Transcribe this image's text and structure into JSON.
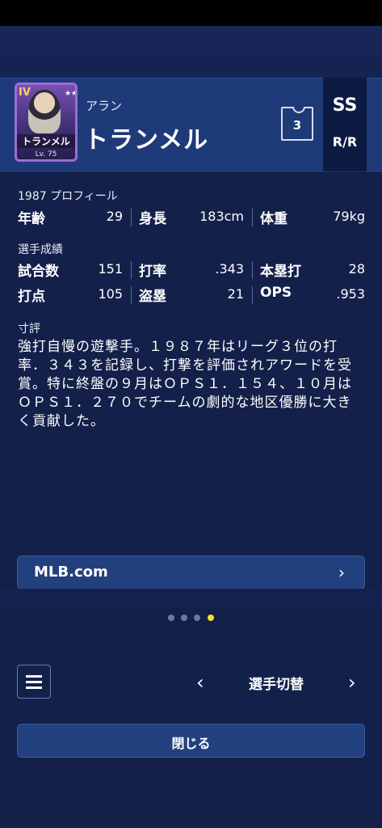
{
  "player": {
    "first_name": "アラン",
    "last_name": "トランメル",
    "card_name": "トランメル",
    "card_rank": "IV",
    "card_level": "Lv. 75",
    "number": "3",
    "position": "SS",
    "bats_throws": "R/R"
  },
  "profile": {
    "section_label": "1987 プロフィール",
    "age_label": "年齢",
    "age_value": "29",
    "height_label": "身長",
    "height_value": "183cm",
    "weight_label": "体重",
    "weight_value": "79kg"
  },
  "stats": {
    "section_label": "選手成績",
    "games_label": "試合数",
    "games_value": "151",
    "avg_label": "打率",
    "avg_value": ".343",
    "hr_label": "本塁打",
    "hr_value": "28",
    "rbi_label": "打点",
    "rbi_value": "105",
    "sb_label": "盗塁",
    "sb_value": "21",
    "ops_label": "OPS",
    "ops_value": ".953"
  },
  "review": {
    "section_label": "寸評",
    "text": "強打自慢の遊撃手。１９８７年はリーグ３位の打率．３４３を記録し、打撃を評価されアワードを受賞。特に終盤の９月はＯＰＳ１．１５４、１０月はＯＰＳ１．２７０でチームの劇的な地区優勝に大きく貢献した。"
  },
  "link": {
    "label": "MLB.com"
  },
  "pagination": {
    "total": 4,
    "active_index": 3
  },
  "footer": {
    "switch_label": "選手切替",
    "close_label": "閉じる"
  },
  "icons": {
    "chevron": "chevron-right-icon",
    "prev": "chevron-left-icon",
    "next": "chevron-right-icon",
    "menu": "hamburger-menu-icon"
  },
  "colors": {
    "background": "#13204a",
    "header": "#1f3a78",
    "accent_dot": "#f3e130"
  }
}
